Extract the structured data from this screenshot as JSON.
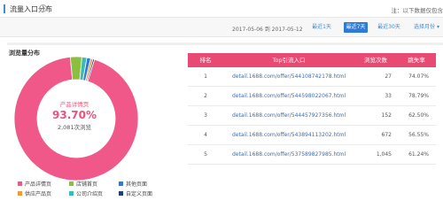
{
  "header": {
    "title": "流量入口分布",
    "help_icon": "question-circle-icon",
    "note": "注：以下数据仅包含"
  },
  "filters": {
    "date_range": "2017-05-06 到 2017-05-12",
    "buttons": [
      {
        "label": "最近1天",
        "active": false
      },
      {
        "label": "最近7天",
        "active": true
      },
      {
        "label": "最近30天",
        "active": false
      },
      {
        "label": "选择月份 ▾",
        "active": false
      }
    ]
  },
  "distribution": {
    "title": "浏览量分布",
    "highlight": {
      "name": "产品详情页",
      "percent": "93.70%",
      "views": "2,081次浏览"
    },
    "segments": [
      {
        "name": "产品详情页",
        "percent": 93.7,
        "color": "#f0588a"
      },
      {
        "name": "店铺首页",
        "percent": 3.0,
        "color": "#8cbf3f"
      },
      {
        "name": "公司介绍页",
        "percent": 1.3,
        "color": "#3cbcb0"
      },
      {
        "name": "其他页面",
        "percent": 1.0,
        "color": "#2f7ad4"
      },
      {
        "name": "供应产品页",
        "percent": 0.6,
        "color": "#f29a38"
      },
      {
        "name": "自定义页面",
        "percent": 0.4,
        "color": "#1f3f7a"
      }
    ],
    "legend": [
      {
        "label": "产品详情页",
        "color": "#f0588a"
      },
      {
        "label": "店铺首页",
        "color": "#8cbf3f"
      },
      {
        "label": "其他页面",
        "color": "#2f7ad4"
      },
      {
        "label": "供应产品页",
        "color": "#f29a38"
      },
      {
        "label": "公司介绍页",
        "color": "#3cbcb0"
      },
      {
        "label": "自定义页面",
        "color": "#1f3f7a"
      }
    ]
  },
  "table": {
    "columns": [
      "排名",
      "Top引流入口",
      "浏览次数",
      "跳失率"
    ],
    "rows": [
      {
        "rank": "1",
        "url": "detail.1688.com/offer/544108742178.html",
        "views": "27",
        "bounce": "74.07%"
      },
      {
        "rank": "2",
        "url": "detail.1688.com/offer/544598022067.html",
        "views": "33",
        "bounce": "78.79%"
      },
      {
        "rank": "3",
        "url": "detail.1688.com/offer/544457927356.html",
        "views": "152",
        "bounce": "62.50%"
      },
      {
        "rank": "4",
        "url": "detail.1688.com/offer/543894113202.html",
        "views": "672",
        "bounce": "56.55%"
      },
      {
        "rank": "5",
        "url": "detail.1688.com/offer/537589827985.html",
        "views": "1,045",
        "bounce": "61.24%"
      }
    ]
  }
}
